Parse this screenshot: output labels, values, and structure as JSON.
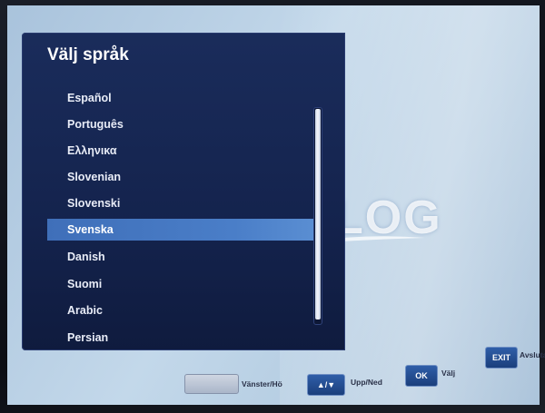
{
  "screen": {
    "title": "Välj språk",
    "watermark": "DILOG"
  },
  "languages": [
    {
      "label": "Español"
    },
    {
      "label": "Português"
    },
    {
      "label": "Ελληνικα"
    },
    {
      "label": "Slovenian"
    },
    {
      "label": "Slovenski"
    },
    {
      "label": "Svenska",
      "selected": true
    },
    {
      "label": "Danish"
    },
    {
      "label": "Suomi"
    },
    {
      "label": "Arabic"
    },
    {
      "label": "Persian"
    }
  ],
  "footer": {
    "left_label": "Vänster/Hö",
    "updown_key": "▲/▼",
    "updown_label": "Upp/Ned",
    "ok_key": "OK",
    "ok_label": "Välj",
    "exit_key": "EXIT",
    "exit_label": "Avsluta"
  },
  "colors": {
    "panel": "#14234d",
    "selected": "#4a7ec8",
    "screen": "#b5cde2"
  }
}
